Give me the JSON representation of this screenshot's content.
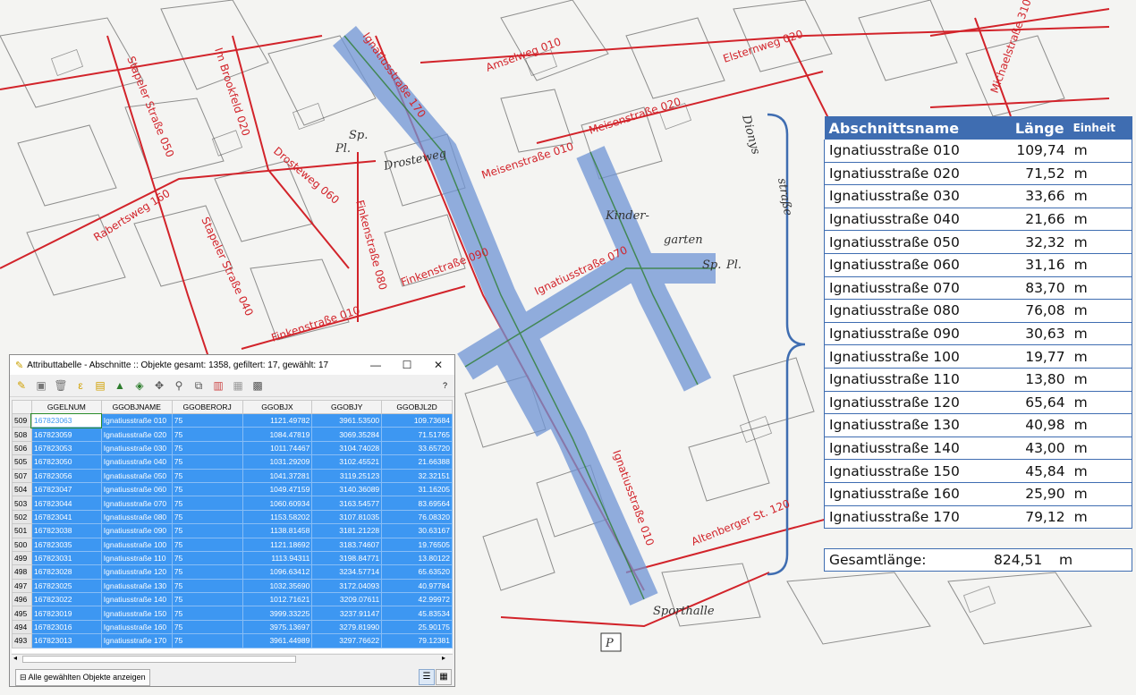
{
  "map": {
    "street_labels": [
      "Ignatiusstraße 170",
      "Amselweg 010",
      "Elsternweg 020",
      "Meisenstraße 020",
      "Michaelstraße 310",
      "Stapeler Straße 050",
      "Im Brookfeld 020",
      "Drosteweg 060",
      "Rabertsweg 160",
      "Stapeler Straße 040",
      "Finkenstraße 080",
      "Finkenstraße 090",
      "Finkenstraße 010",
      "Meisenstraße 010",
      "Ignatiusstraße 070",
      "Ignatiusstraße 010",
      "Altenberger St. 120"
    ],
    "text_labels": [
      "Kinder-",
      "garten",
      "Sp.",
      "Pl.",
      "Sporthalle",
      "P",
      "Drosteweg",
      "Dionys",
      "straße"
    ]
  },
  "summary_table": {
    "headers": {
      "name": "Abschnittsname",
      "length": "Länge",
      "unit": "Einheit"
    },
    "rows": [
      {
        "name": "Ignatiusstraße 010",
        "length": "109,74",
        "unit": "m"
      },
      {
        "name": "Ignatiusstraße 020",
        "length": "71,52",
        "unit": "m"
      },
      {
        "name": "Ignatiusstraße 030",
        "length": "33,66",
        "unit": "m"
      },
      {
        "name": "Ignatiusstraße 040",
        "length": "21,66",
        "unit": "m"
      },
      {
        "name": "Ignatiusstraße 050",
        "length": "32,32",
        "unit": "m"
      },
      {
        "name": "Ignatiusstraße 060",
        "length": "31,16",
        "unit": "m"
      },
      {
        "name": "Ignatiusstraße 070",
        "length": "83,70",
        "unit": "m"
      },
      {
        "name": "Ignatiusstraße 080",
        "length": "76,08",
        "unit": "m"
      },
      {
        "name": "Ignatiusstraße 090",
        "length": "30,63",
        "unit": "m"
      },
      {
        "name": "Ignatiusstraße 100",
        "length": "19,77",
        "unit": "m"
      },
      {
        "name": "Ignatiusstraße 110",
        "length": "13,80",
        "unit": "m"
      },
      {
        "name": "Ignatiusstraße 120",
        "length": "65,64",
        "unit": "m"
      },
      {
        "name": "Ignatiusstraße 130",
        "length": "40,98",
        "unit": "m"
      },
      {
        "name": "Ignatiusstraße 140",
        "length": "43,00",
        "unit": "m"
      },
      {
        "name": "Ignatiusstraße 150",
        "length": "45,84",
        "unit": "m"
      },
      {
        "name": "Ignatiusstraße 160",
        "length": "25,90",
        "unit": "m"
      },
      {
        "name": "Ignatiusstraße 170",
        "length": "79,12",
        "unit": "m"
      }
    ],
    "total": {
      "label": "Gesamtlänge:",
      "length": "824,51",
      "unit": "m"
    }
  },
  "attribute_window": {
    "title": "Attributtabelle - Abschnitte :: Objekte gesamt: 1358, gefiltert: 17, gewählt: 17",
    "minimize": "—",
    "maximize": "☐",
    "close": "✕",
    "help": "?",
    "columns": [
      "GGELNUM",
      "GGOBJNAME",
      "GGOBERORJ",
      "GGOBJX",
      "GGOBJY",
      "GGOBJL2D"
    ],
    "rows": [
      {
        "n": "509",
        "c": [
          "167823063",
          "Ignatiusstraße 010",
          "75",
          "1121.49782",
          "3961.53500",
          "109.73684"
        ]
      },
      {
        "n": "508",
        "c": [
          "167823059",
          "Ignatiusstraße 020",
          "75",
          "1084.47819",
          "3069.35284",
          "71.51765"
        ]
      },
      {
        "n": "506",
        "c": [
          "167823053",
          "Ignatiusstraße 030",
          "75",
          "1011.74467",
          "3104.74028",
          "33.65720"
        ]
      },
      {
        "n": "505",
        "c": [
          "167823050",
          "Ignatiusstraße 040",
          "75",
          "1031.29209",
          "3102.45521",
          "21.66388"
        ]
      },
      {
        "n": "507",
        "c": [
          "167823056",
          "Ignatiusstraße 050",
          "75",
          "1041.37281",
          "3119.25123",
          "32.32151"
        ]
      },
      {
        "n": "504",
        "c": [
          "167823047",
          "Ignatiusstraße 060",
          "75",
          "1049.47159",
          "3140.36089",
          "31.16205"
        ]
      },
      {
        "n": "503",
        "c": [
          "167823044",
          "Ignatiusstraße 070",
          "75",
          "1060.60934",
          "3163.54577",
          "83.69564"
        ]
      },
      {
        "n": "502",
        "c": [
          "167823041",
          "Ignatiusstraße 080",
          "75",
          "1153.58202",
          "3107.81035",
          "76.08320"
        ]
      },
      {
        "n": "501",
        "c": [
          "167823038",
          "Ignatiusstraße 090",
          "75",
          "1138.81458",
          "3181.21228",
          "30.63167"
        ]
      },
      {
        "n": "500",
        "c": [
          "167823035",
          "Ignatiusstraße 100",
          "75",
          "1121.18692",
          "3183.74607",
          "19.76505"
        ]
      },
      {
        "n": "499",
        "c": [
          "167823031",
          "Ignatiusstraße 110",
          "75",
          "1113.94311",
          "3198.84771",
          "13.80122"
        ]
      },
      {
        "n": "498",
        "c": [
          "167823028",
          "Ignatiusstraße 120",
          "75",
          "1096.63412",
          "3234.57714",
          "65.63520"
        ]
      },
      {
        "n": "497",
        "c": [
          "167823025",
          "Ignatiusstraße 130",
          "75",
          "1032.35690",
          "3172.04093",
          "40.97784"
        ]
      },
      {
        "n": "496",
        "c": [
          "167823022",
          "Ignatiusstraße 140",
          "75",
          "1012.71621",
          "3209.07611",
          "42.99972"
        ]
      },
      {
        "n": "495",
        "c": [
          "167823019",
          "Ignatiusstraße 150",
          "75",
          "3999.33225",
          "3237.91147",
          "45.83534"
        ]
      },
      {
        "n": "494",
        "c": [
          "167823016",
          "Ignatiusstraße 160",
          "75",
          "3975.13697",
          "3279.81990",
          "25.90175"
        ]
      },
      {
        "n": "493",
        "c": [
          "167823013",
          "Ignatiusstraße 170",
          "75",
          "3961.44989",
          "3297.76622",
          "79.12381"
        ]
      }
    ],
    "footer_button": "Alle gewählten Objekte anzeigen",
    "colors": {
      "selection": "#3d97f2",
      "header_blue": "#3f6db1",
      "street_red": "#d2232a"
    }
  }
}
